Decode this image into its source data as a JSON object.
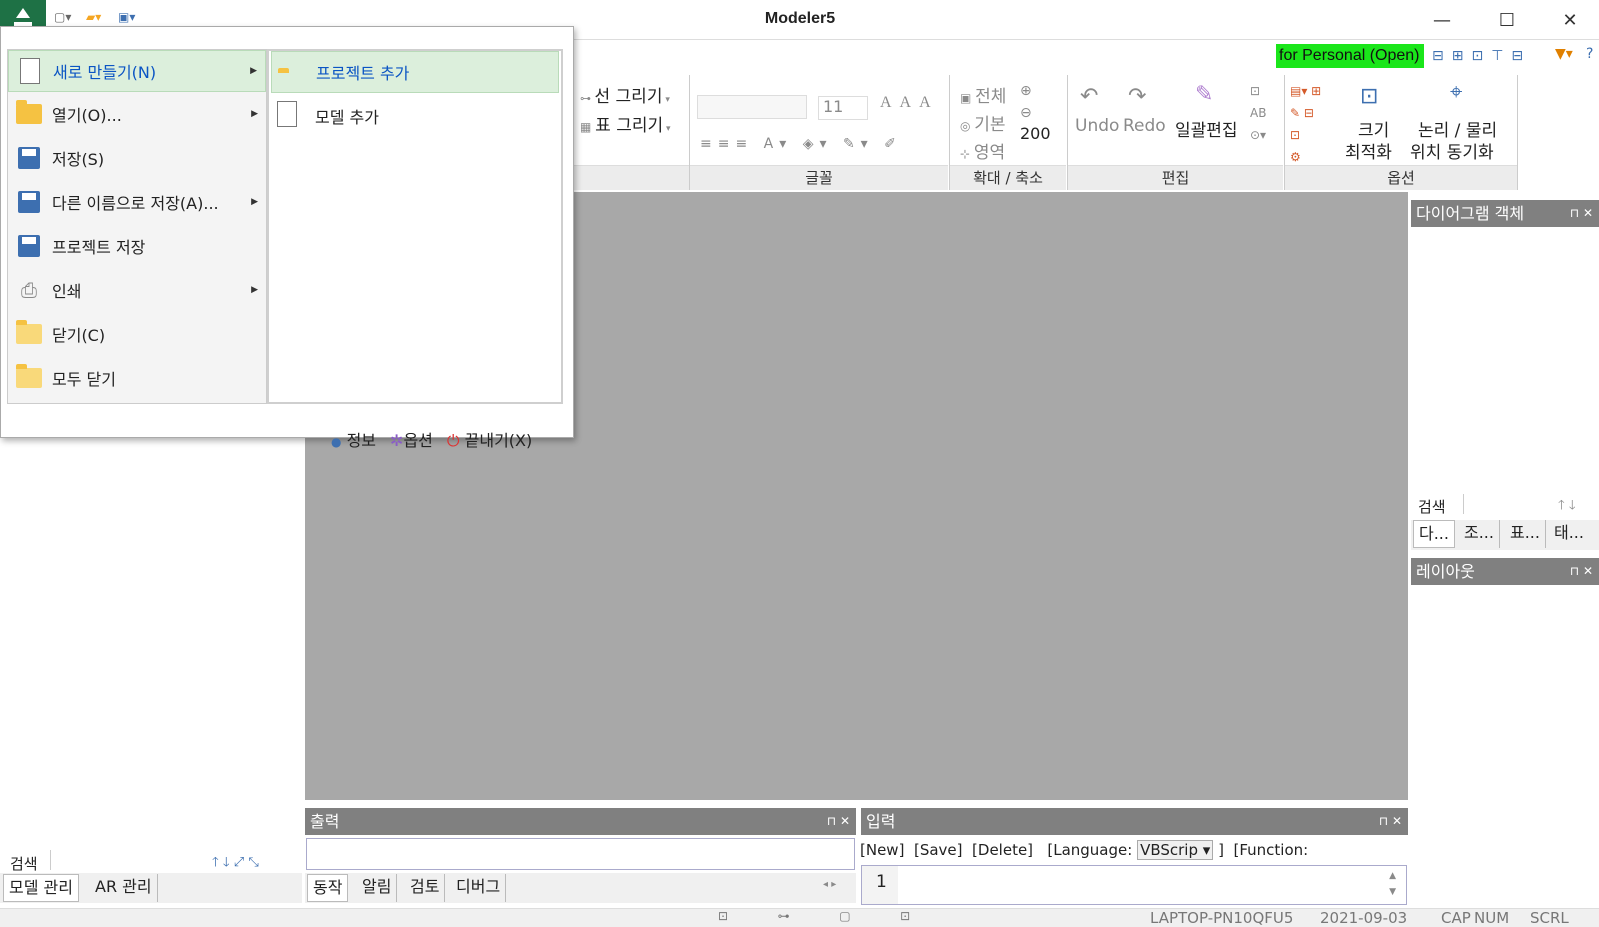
{
  "app": {
    "title": "Modeler5"
  },
  "window": {
    "minimize": "—",
    "maximize": "☐",
    "close": "✕"
  },
  "ribbon": {
    "personal": "for Personal (Open)",
    "draw_line": "선 그리기",
    "draw_table": "표 그리기",
    "font_size": "11",
    "zoom_all": "전체",
    "zoom_default": "기본",
    "zoom_area": "영역",
    "zoom_value": "200",
    "undo": "Undo",
    "redo": "Redo",
    "batch_edit": "일괄편집",
    "size_opt_1": "크기",
    "size_opt_2": "최적화",
    "sync_1": "논리 / 물리",
    "sync_2": "위치 동기화",
    "groups": {
      "font": "글꼴",
      "zoom": "확대 / 축소",
      "edit": "편집",
      "option": "옵션"
    }
  },
  "menu": {
    "items": [
      {
        "label": "새로 만들기(N)",
        "icon": "new-document-icon"
      },
      {
        "label": "열기(O)...",
        "icon": "open-folder-icon"
      },
      {
        "label": "저장(S)",
        "icon": "save-icon"
      },
      {
        "label": "다른 이름으로 저장(A)...",
        "icon": "save-as-icon"
      },
      {
        "label": "프로젝트 저장",
        "icon": "save-project-icon"
      },
      {
        "label": "인쇄",
        "icon": "print-icon"
      },
      {
        "label": "닫기(C)",
        "icon": "close-folder-icon"
      },
      {
        "label": "모두 닫기",
        "icon": "close-all-icon"
      }
    ],
    "submenu": [
      {
        "label": "프로젝트 추가",
        "icon": "add-project-icon"
      },
      {
        "label": "모델 추가",
        "icon": "add-model-icon"
      }
    ],
    "footer": {
      "info": "정보",
      "options": "옵션",
      "exit": "끝내기(X)"
    }
  },
  "left_panel": {
    "search": "검색",
    "tabs": [
      "모델 관리",
      "AR 관리"
    ]
  },
  "right_panel": {
    "diagram_objects": "다이어그램 객체",
    "search": "검색",
    "tabs": [
      "다...",
      "조...",
      "표...",
      "태..."
    ],
    "layout": "레이아웃"
  },
  "output_panel": {
    "title": "출력",
    "tabs": [
      "동작",
      "알림",
      "검토",
      "디버그"
    ]
  },
  "input_panel": {
    "title": "입력",
    "new": "[New]",
    "save": "[Save]",
    "delete": "[Delete]",
    "language": "[Language:",
    "language_value": "VBScrip",
    "bracket_close": "]",
    "function": "[Function:",
    "line_number": "1"
  },
  "status": {
    "host": "LAPTOP-PN10QFU5",
    "date": "2021-09-03",
    "cap": "CAP",
    "num": "NUM",
    "scrl": "SCRL"
  }
}
